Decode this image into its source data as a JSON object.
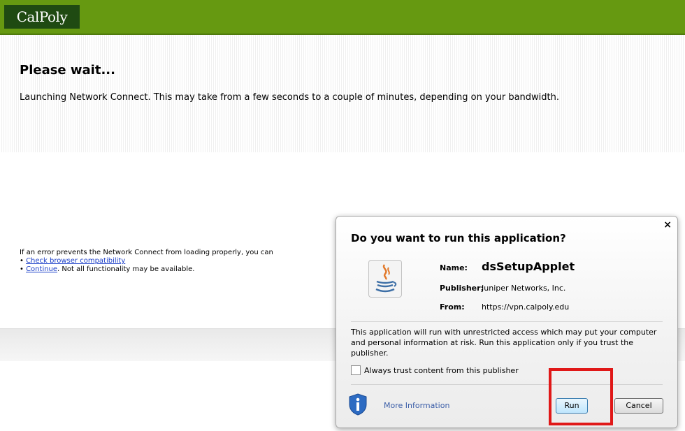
{
  "header": {
    "logo_text": "CalPoly",
    "bar_color": "#669911",
    "logo_bg": "#1f4a12"
  },
  "main": {
    "title": "Please wait...",
    "description": "Launching Network Connect. This may take from a few seconds to a couple of minutes, depending on your bandwidth."
  },
  "error_block": {
    "intro": "If an error prevents the Network Connect from loading properly, you can",
    "link1": "Check browser compatibility",
    "link2": "Continue",
    "link2_suffix": ". Not all functionality may be available."
  },
  "dialog": {
    "close": "×",
    "title": "Do you want to run this application?",
    "name_label": "Name:",
    "name_value": "dsSetupApplet",
    "publisher_label": "Publisher:",
    "publisher_value": "Juniper Networks, Inc.",
    "from_label": "From:",
    "from_value": "https://vpn.calpoly.edu",
    "warning": "This application will run with unrestricted access which may put your computer and personal information at risk. Run this application only if you trust the publisher.",
    "trust_label": "Always trust content from this publisher",
    "more_info": "More Information",
    "run_label": "Run",
    "cancel_label": "Cancel",
    "icon": "java-icon",
    "info_icon": "info-shield-icon",
    "highlight_color": "#e01818"
  }
}
